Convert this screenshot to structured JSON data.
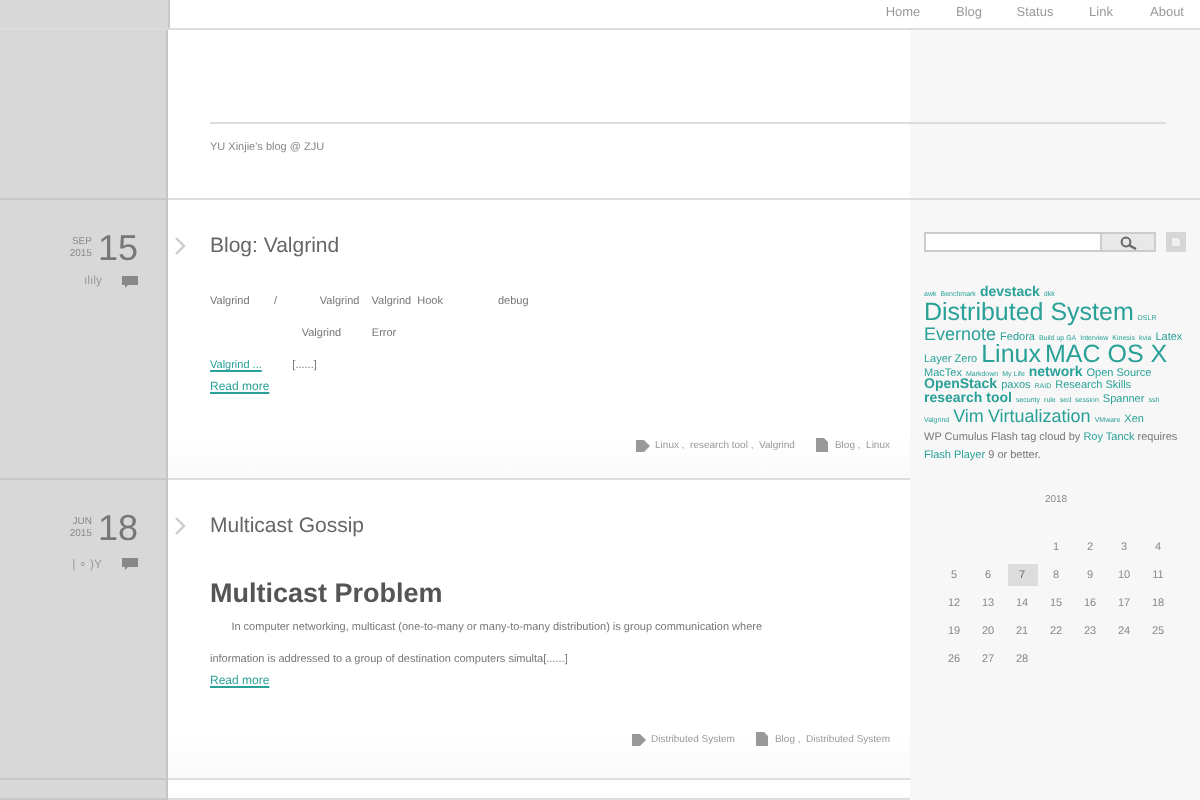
{
  "nav": [
    {
      "label": "Home",
      "selected": false
    },
    {
      "label": "Blog",
      "selected": false
    },
    {
      "label": "Status",
      "selected": false
    },
    {
      "label": "Link",
      "selected": false
    },
    {
      "label": "About",
      "selected": false
    }
  ],
  "header": {
    "tagline": "YU Xinjie's blog @ ZJU"
  },
  "posts": [
    {
      "month": "SEP",
      "year": "2015",
      "day": "15",
      "meta": "ılıly",
      "title": "Blog: Valgrind",
      "body": [
        {
          "kind": "line",
          "segments": [
            {
              "text": "Valgrind        /              Valgrind    Valgrind  Hook                  debug",
              "link": false
            }
          ]
        },
        {
          "kind": "line",
          "segments": [
            {
              "text": "                              Valgrind          Error",
              "link": false
            }
          ]
        },
        {
          "kind": "line",
          "segments": [
            {
              "text": "Valgrind ...",
              "link": true
            },
            {
              "text": "          [......]",
              "link": false
            }
          ]
        }
      ],
      "read_more": "Read more",
      "tags": "Linux ,  research tool ,  Valgrind",
      "categories": "Blog ,  Linux"
    },
    {
      "month": "JUN",
      "year": "2015",
      "day": "18",
      "meta": "| ∘ )Y",
      "title": "Multicast Gossip",
      "body": [
        {
          "kind": "heading",
          "text": "Multicast Problem"
        },
        {
          "kind": "line",
          "segments": [
            {
              "text": "       In computer networking, multicast (one-to-many or many-to-many distribution) is group communication where",
              "link": false
            }
          ]
        },
        {
          "kind": "line",
          "segments": [
            {
              "text": "information is addressed to a group of destination computers simulta[......]",
              "link": false
            }
          ]
        }
      ],
      "read_more": "Read more",
      "tags": "Distributed System",
      "categories": "Blog ,  Distributed System"
    }
  ],
  "sidebar": {
    "tag_cloud": [
      {
        "label": "awk",
        "kind": "xs"
      },
      {
        "label": "Benchmark",
        "kind": "xs"
      },
      {
        "label": "devstack",
        "kind": "mb"
      },
      {
        "label": "dkk",
        "kind": "xs"
      },
      {
        "label": "Distributed System",
        "kind": "xl"
      },
      {
        "label": "DSLR",
        "kind": "xs"
      },
      {
        "label": "Evernote",
        "kind": "l"
      },
      {
        "label": "Fedora",
        "kind": "s"
      },
      {
        "label": "Build up GA",
        "kind": "xs"
      },
      {
        "label": "Interview",
        "kind": "xs"
      },
      {
        "label": "Kinesis",
        "kind": "xs"
      },
      {
        "label": "kvia",
        "kind": "xs"
      },
      {
        "label": "Latex",
        "kind": "s"
      },
      {
        "label": "Layer Zero",
        "kind": "s"
      },
      {
        "label": "Linux",
        "kind": "xl"
      },
      {
        "label": "MAC OS X",
        "kind": "xl"
      },
      {
        "label": "MacTex",
        "kind": "s"
      },
      {
        "label": "Markdown",
        "kind": "xs"
      },
      {
        "label": "My Life",
        "kind": "xs"
      },
      {
        "label": "network",
        "kind": "mb"
      },
      {
        "label": "Open Source",
        "kind": "s"
      },
      {
        "label": "OpenStack",
        "kind": "mb"
      },
      {
        "label": "paxos",
        "kind": "s"
      },
      {
        "label": "RAID",
        "kind": "xs"
      },
      {
        "label": "Research Skills",
        "kind": "s"
      },
      {
        "label": "research tool",
        "kind": "mb"
      },
      {
        "label": "security",
        "kind": "xs"
      },
      {
        "label": "rule",
        "kind": "xs"
      },
      {
        "label": "sed",
        "kind": "xs"
      },
      {
        "label": "session",
        "kind": "xs"
      },
      {
        "label": "Spanner",
        "kind": "s"
      },
      {
        "label": "ssh",
        "kind": "xs"
      },
      {
        "label": "Valgrind",
        "kind": "xs"
      },
      {
        "label": "Vim",
        "kind": "l"
      },
      {
        "label": "Virtualization",
        "kind": "l"
      },
      {
        "label": "VMware",
        "kind": "xs"
      },
      {
        "label": "Xen",
        "kind": "s"
      }
    ],
    "cloud_note": [
      {
        "text": "WP Cumulus Flash tag cloud by ",
        "link": false
      },
      {
        "text": "Roy Tanck",
        "link": true
      },
      {
        "text": " requires ",
        "link": false
      },
      {
        "text": "Flash Player",
        "link": true
      },
      {
        "text": " 9 or better.",
        "link": false
      }
    ],
    "calendar": {
      "title": "2018",
      "weeks": [
        {
          "kind": "partial-start",
          "days": [
            {
              "day": "1",
              "selected": false
            },
            {
              "day": "2",
              "selected": false
            },
            {
              "day": "3",
              "selected": false
            },
            {
              "day": "4",
              "selected": false
            }
          ]
        },
        {
          "kind": "full",
          "days": [
            {
              "day": "5",
              "selected": false
            },
            {
              "day": "6",
              "selected": false
            },
            {
              "day": "7",
              "selected": true
            },
            {
              "day": "8",
              "selected": false
            },
            {
              "day": "9",
              "selected": false
            },
            {
              "day": "10",
              "selected": false
            },
            {
              "day": "11",
              "selected": false
            }
          ]
        },
        {
          "kind": "full",
          "days": [
            {
              "day": "12",
              "selected": false
            },
            {
              "day": "13",
              "selected": false
            },
            {
              "day": "14",
              "selected": false
            },
            {
              "day": "15",
              "selected": false
            },
            {
              "day": "16",
              "selected": false
            },
            {
              "day": "17",
              "selected": false
            },
            {
              "day": "18",
              "selected": false
            }
          ]
        },
        {
          "kind": "full",
          "days": [
            {
              "day": "19",
              "selected": false
            },
            {
              "day": "20",
              "selected": false
            },
            {
              "day": "21",
              "selected": false
            },
            {
              "day": "22",
              "selected": false
            },
            {
              "day": "23",
              "selected": false
            },
            {
              "day": "24",
              "selected": false
            },
            {
              "day": "25",
              "selected": false
            }
          ]
        },
        {
          "kind": "full",
          "days": [
            {
              "day": "26",
              "selected": false
            },
            {
              "day": "27",
              "selected": false
            },
            {
              "day": "28",
              "selected": false
            }
          ]
        }
      ]
    }
  }
}
